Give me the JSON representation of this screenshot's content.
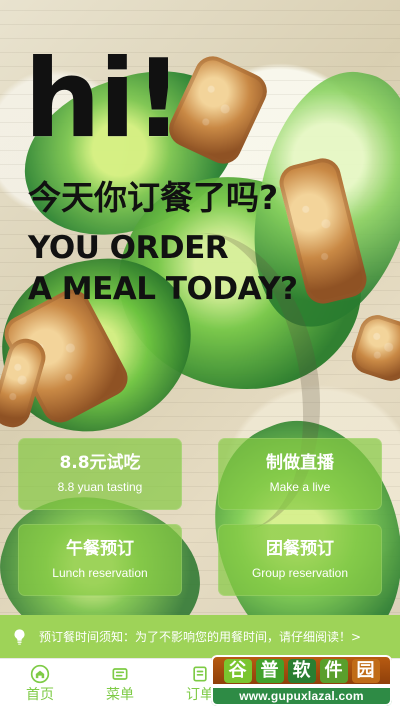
{
  "hero": {
    "title": "hi!",
    "subtitle_cn": "今天你订餐了吗?",
    "subtitle_en_line_1": "YOU ORDER",
    "subtitle_en_line_2": "A MEAL TODAY?"
  },
  "cards": [
    {
      "title_cn": "8.8元试吃",
      "title_en": "8.8 yuan tasting"
    },
    {
      "title_cn": "制做直播",
      "title_en": "Make a live"
    },
    {
      "title_cn": "午餐预订",
      "title_en": "Lunch reservation"
    },
    {
      "title_cn": "团餐预订",
      "title_en": "Group reservation"
    }
  ],
  "notice": {
    "icon": "lightbulb-icon",
    "text": "预订餐时间须知：为了不影响您的用餐时间，请仔细阅读！>"
  },
  "bottom_nav": [
    {
      "label": "首页",
      "icon": "home-icon"
    },
    {
      "label": "菜单",
      "icon": "menu-icon"
    },
    {
      "label": "订单",
      "icon": "orders-icon"
    }
  ],
  "watermark": {
    "chars": [
      "谷",
      "普",
      "软",
      "件",
      "园"
    ],
    "url": "www.gupuxlazal.com"
  },
  "colors": {
    "accent": "#7ecb46",
    "card_background": "#84c943",
    "notice_background": "#9ed358",
    "headline": "#111111"
  }
}
